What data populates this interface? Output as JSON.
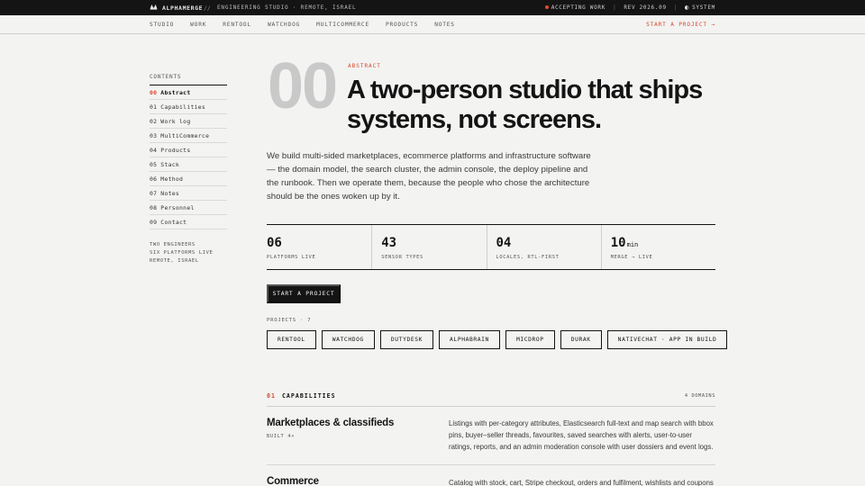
{
  "topbar": {
    "brand": "ALPHAMERGE",
    "separator": "//",
    "tagline": "ENGINEERING STUDIO · REMOTE, ISRAEL",
    "status": "ACCEPTING WORK",
    "status_color": "#e04a2a",
    "rev": "REV 2026.09",
    "theme": "SYSTEM",
    "bar_divider": "|"
  },
  "nav": {
    "items": [
      "STUDIO",
      "WORK",
      "RENTOOL",
      "WATCHDOG",
      "MULTICOMMERCE",
      "PRODUCTS",
      "NOTES"
    ],
    "cta": "START A PROJECT →"
  },
  "toc": {
    "heading": "CONTENTS",
    "items": [
      {
        "num": "00",
        "label": "Abstract"
      },
      {
        "num": "01",
        "label": "Capabilities"
      },
      {
        "num": "02",
        "label": "Work log"
      },
      {
        "num": "03",
        "label": "MultiCommerce"
      },
      {
        "num": "04",
        "label": "Products"
      },
      {
        "num": "05",
        "label": "Stack"
      },
      {
        "num": "06",
        "label": "Method"
      },
      {
        "num": "07",
        "label": "Notes"
      },
      {
        "num": "08",
        "label": "Personnel"
      },
      {
        "num": "09",
        "label": "Contact"
      }
    ],
    "active_index": 0,
    "meta": [
      "TWO ENGINEERS",
      "SIX PLATFORMS LIVE",
      "REMOTE, ISRAEL"
    ]
  },
  "hero": {
    "section_number": "00",
    "eyebrow": "ABSTRACT",
    "headline": "A two-person studio that ships systems, not screens.",
    "lede": "We build multi-sided marketplaces, ecommerce platforms and infrastructure software — the domain model, the search cluster, the admin console, the deploy pipeline and the runbook. Then we operate them, because the people who chose the architecture should be the ones woken up by it."
  },
  "stats": [
    {
      "value": "06",
      "unit": "",
      "label": "PLATFORMS LIVE"
    },
    {
      "value": "43",
      "unit": "",
      "label": "SENSOR TYPES"
    },
    {
      "value": "04",
      "unit": "",
      "label": "LOCALES, RTL-FIRST"
    },
    {
      "value": "10",
      "unit": "min",
      "label": "MERGE → LIVE"
    }
  ],
  "start_button": "START A PROJECT",
  "projects": {
    "label": "PROJECTS · 7",
    "chips": [
      "RENTOOL",
      "WATCHDOG",
      "DUTYDESK",
      "ALPHABRAIN",
      "MICDROP",
      "DURAK",
      "NATIVECHAT · APP IN BUILD"
    ]
  },
  "capabilities": {
    "num": "01",
    "title": "CAPABILITIES",
    "count": "4 DOMAINS",
    "rows": [
      {
        "title": "Marketplaces & classifieds",
        "sub": "BUILT 4×",
        "desc": "Listings with per-category attributes, Elasticsearch full-text and map search with bbox pins, buyer–seller threads, favourites, saved searches with alerts, user-to-user ratings, reports, and an admin moderation console with user dossiers and event logs."
      },
      {
        "title": "Commerce",
        "sub": "",
        "desc": "Catalog with stock, cart, Stripe checkout, orders and fulfilment, wishlists and coupons"
      }
    ]
  },
  "colors": {
    "accent": "#d9482b",
    "ink": "#141414",
    "paper": "#f3f3f2",
    "muted_numeral": "#c9c9c9"
  }
}
